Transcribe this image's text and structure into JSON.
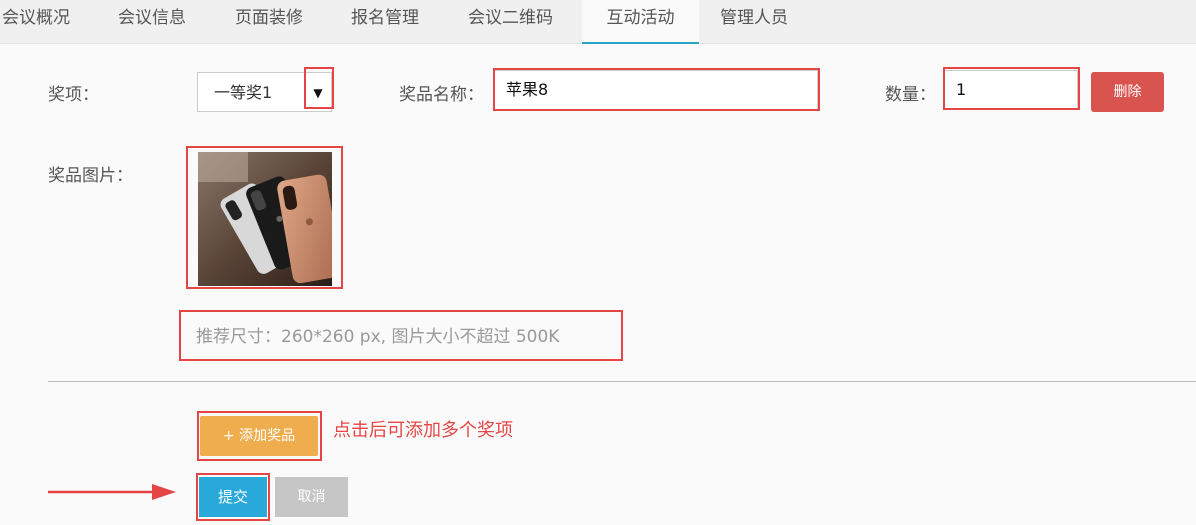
{
  "tabs": [
    {
      "label": "会议概况"
    },
    {
      "label": "会议信息"
    },
    {
      "label": "页面装修"
    },
    {
      "label": "报名管理"
    },
    {
      "label": "会议二维码"
    },
    {
      "label": "互动活动",
      "active": true
    },
    {
      "label": "管理人员"
    }
  ],
  "form": {
    "prize_label": "奖项：",
    "prize_select_value": "一等奖1",
    "prize_name_label": "奖品名称：",
    "prize_name_value": "苹果8",
    "quantity_label": "数量：",
    "quantity_value": "1",
    "delete_label": "删除",
    "image_label": "奖品图片：",
    "image_hint": "推荐尺寸：260*260 px, 图片大小不超过 500K"
  },
  "actions": {
    "add_prize_label": "+ 添加奖品",
    "add_prize_note": "点击后可添加多个奖项",
    "submit_label": "提交",
    "cancel_label": "取消"
  },
  "colors": {
    "annotation_red": "#e64545",
    "tab_active_underline": "#2aa3c8",
    "delete_button": "#d9534f",
    "add_button": "#f0ad4e",
    "submit_button": "#29a8da",
    "cancel_button": "#c6c6c6"
  },
  "icons": {
    "select_arrow": "caret-down-icon",
    "annotation_arrow": "arrow-right-icon"
  }
}
